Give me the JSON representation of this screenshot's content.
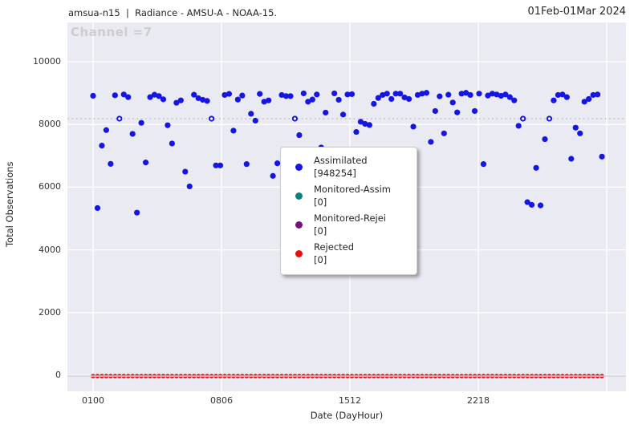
{
  "header": {
    "left_title": "amsua-n15  |  Radiance - AMSU-A - NOAA-15.",
    "right_title": "01Feb-01Mar 2024"
  },
  "chart_data": {
    "type": "scatter",
    "title": "Channel =7",
    "xlabel": "Date (DayHour)",
    "ylabel": "Total Observations",
    "date_range": "01Feb-01Mar 2024",
    "x_ticks": [
      "0100",
      "0806",
      "1512",
      "2218"
    ],
    "y_ticks": [
      "0",
      "2000",
      "4000",
      "6000",
      "8000",
      "10000"
    ],
    "y_tick_values": [
      0,
      2000,
      4000,
      6000,
      8000,
      10000
    ],
    "ylim": [
      0,
      11250
    ],
    "grid": true,
    "legend_position": "center",
    "interval_hours": 6,
    "mean_line_value": 8180,
    "mean_marker_indices": [
      6,
      27,
      46,
      98,
      104
    ],
    "colors": {
      "plot_background": "#eaeaf2",
      "gridline": "#ffffff",
      "mean_line": "#c9c9c9",
      "zero_line": "#d2d2da"
    },
    "series": [
      {
        "name": "Assimilated",
        "count": 948254,
        "color": "#1515e6",
        "values": [
          8914,
          5333,
          7325,
          7820,
          6743,
          8930,
          8185,
          8956,
          8871,
          7699,
          5187,
          8051,
          6787,
          8871,
          8948,
          8904,
          8802,
          7974,
          7392,
          8691,
          8768,
          6495,
          6025,
          8948,
          8838,
          8787,
          8750,
          8185,
          6693,
          6693,
          8940,
          8974,
          7802,
          8794,
          8922,
          6735,
          8341,
          8120,
          8974,
          8725,
          8768,
          6359,
          6761,
          8940,
          8904,
          8904,
          8185,
          7659,
          8992,
          8725,
          8794,
          8956,
          7264,
          8377,
          6900,
          8992,
          8787,
          8315,
          8956,
          8966,
          7761,
          8085,
          8018,
          7982,
          8658,
          8845,
          8940,
          8982,
          8812,
          8982,
          8982,
          8863,
          8812,
          7930,
          8940,
          8982,
          9008,
          7444,
          8428,
          8897,
          7716,
          8948,
          8700,
          8384,
          8982,
          9008,
          8940,
          8428,
          8982,
          6735,
          8922,
          8982,
          8956,
          8914,
          8956,
          8871,
          8768,
          7956,
          8185,
          5521,
          5436,
          6615,
          5418,
          7530,
          8185,
          8768,
          8940,
          8956,
          8871,
          6905,
          7897,
          7716,
          8725,
          8812,
          8940,
          8956,
          6974
        ]
      },
      {
        "name": "Monitored-Assim",
        "count": 0,
        "color": "#0f8080",
        "values": []
      },
      {
        "name": "Monitored-Rejei",
        "count": 0,
        "color": "#7d107d",
        "values": []
      },
      {
        "name": "Rejected",
        "count": 0,
        "color": "#e81010",
        "constant_value": 0,
        "points_count": 117
      }
    ]
  },
  "legend": {
    "items": [
      {
        "label": "Assimilated",
        "count_label": "[948254]",
        "color": "#1515e6"
      },
      {
        "label": "Monitored-Assim",
        "count_label": "[0]",
        "color": "#0f8080"
      },
      {
        "label": "Monitored-Rejei",
        "count_label": "[0]",
        "color": "#7d107d"
      },
      {
        "label": "Rejected",
        "count_label": "[0]",
        "color": "#e81010"
      }
    ]
  }
}
